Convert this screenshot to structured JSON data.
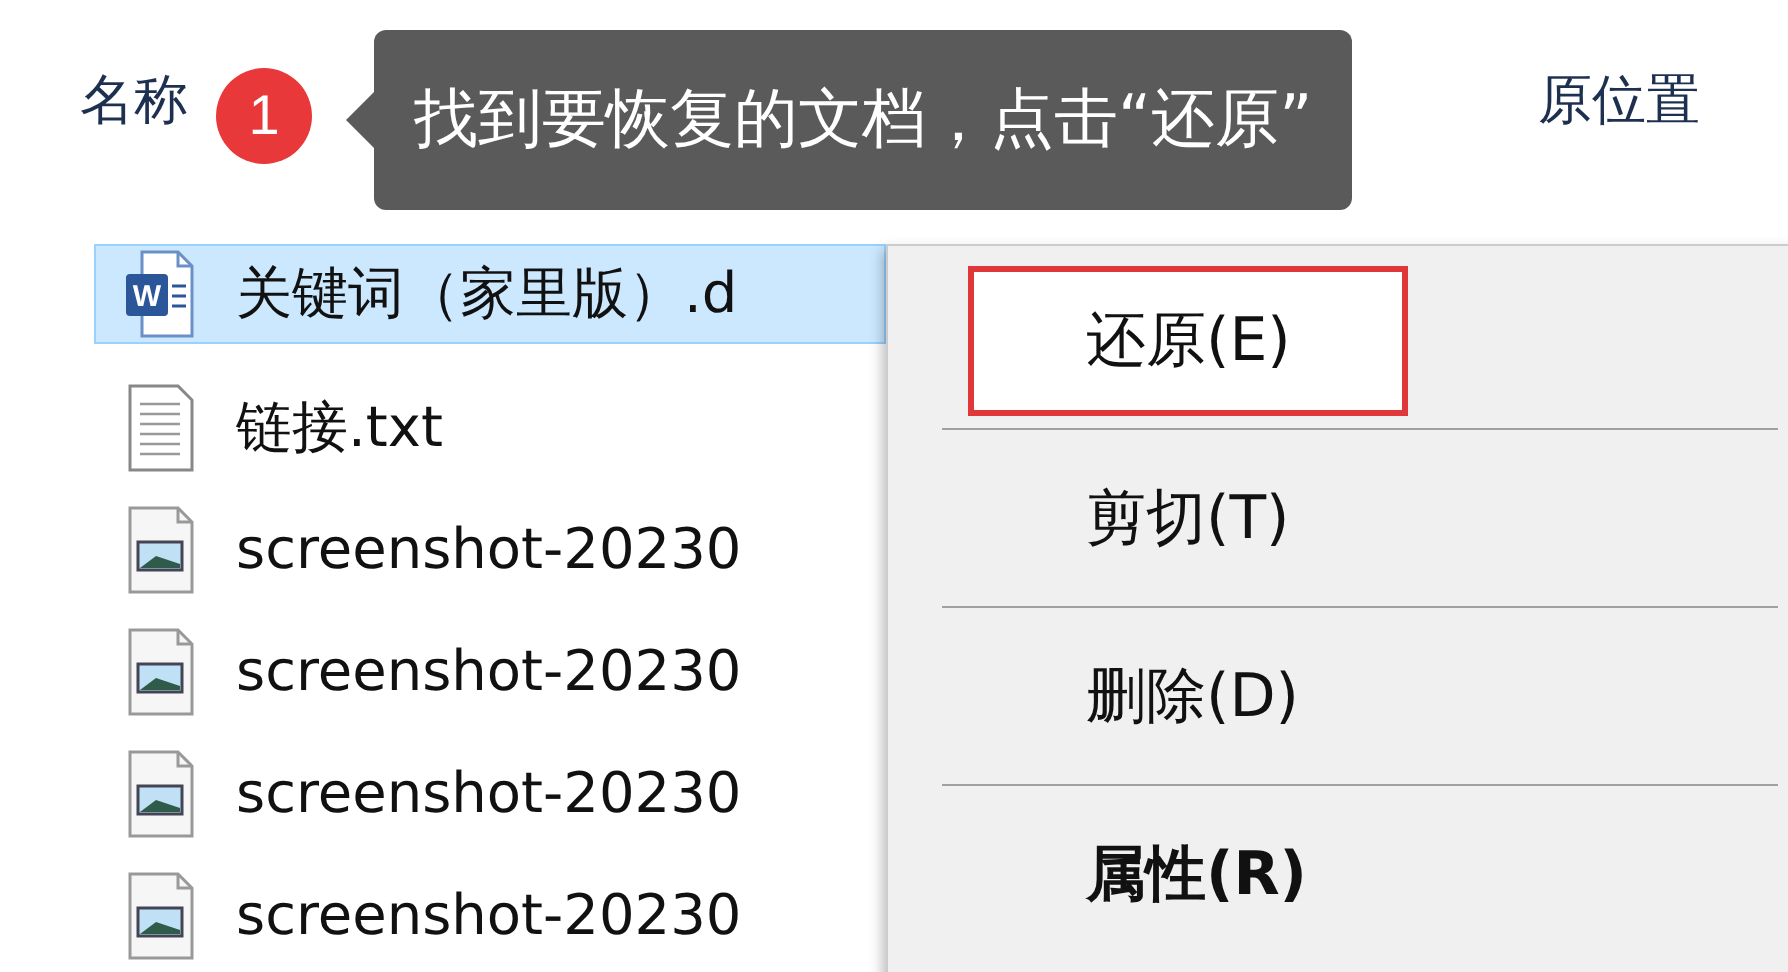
{
  "columns": [
    {
      "label": "名称"
    },
    {
      "label": "原位置"
    }
  ],
  "callout": {
    "step": "1",
    "text": "找到要恢复的文档，点击“还原”"
  },
  "files": [
    {
      "name": "关键词（家里版）.d",
      "kind": "word",
      "icon_letter": "W",
      "selected": true
    },
    {
      "name": "链接.txt",
      "kind": "text",
      "selected": false
    },
    {
      "name": "screenshot-20230",
      "kind": "image",
      "selected": false
    },
    {
      "name": "screenshot-20230",
      "kind": "image",
      "selected": false
    },
    {
      "name": "screenshot-20230",
      "kind": "image",
      "selected": false
    },
    {
      "name": "screenshot-20230",
      "kind": "image",
      "selected": false
    }
  ],
  "context_menu": [
    {
      "label": "还原(E)",
      "default": false,
      "highlighted": true
    },
    {
      "label": "剪切(T)",
      "default": false,
      "highlighted": false
    },
    {
      "label": "删除(D)",
      "default": false,
      "highlighted": false
    },
    {
      "label": "属性(R)",
      "default": true,
      "highlighted": false
    }
  ]
}
